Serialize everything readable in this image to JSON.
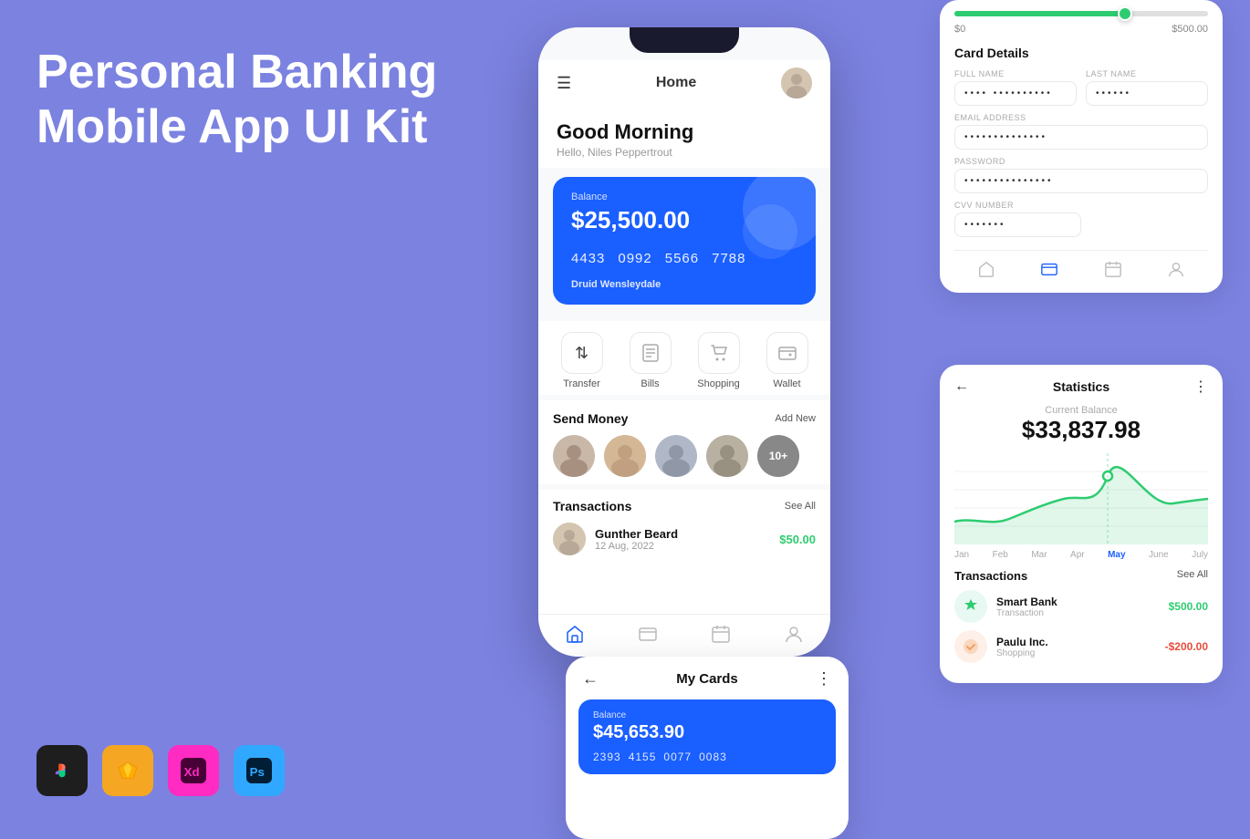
{
  "hero": {
    "title": "Personal Banking Mobile App UI Kit"
  },
  "tools": [
    {
      "name": "Figma",
      "symbol": "✦",
      "class": "tool-figma"
    },
    {
      "name": "Sketch",
      "symbol": "◈",
      "class": "tool-sketch"
    },
    {
      "name": "XD",
      "symbol": "Xd",
      "class": "tool-xd"
    },
    {
      "name": "Ps",
      "symbol": "Ps",
      "class": "tool-ps"
    }
  ],
  "phone_main": {
    "header_title": "Home",
    "greeting_title": "Good Morning",
    "greeting_sub": "Hello, Niles Peppertrout",
    "balance_label": "Balance",
    "balance_amount": "$25,500.00",
    "card_numbers": [
      "4433",
      "0992",
      "5566",
      "7788"
    ],
    "card_holder": "Druid Wensleydale",
    "actions": [
      {
        "label": "Transfer",
        "icon": "↕"
      },
      {
        "label": "Bills",
        "icon": "📋"
      },
      {
        "label": "Shopping",
        "icon": "🛒"
      },
      {
        "label": "Wallet",
        "icon": "▭"
      }
    ],
    "send_money_title": "Send Money",
    "send_money_link": "Add New",
    "contacts_more": "10+",
    "transactions_title": "Transactions",
    "transactions_link": "See All",
    "transaction": {
      "name": "Gunther Beard",
      "date": "12 Aug, 2022",
      "amount": "$50.00"
    }
  },
  "phone_cards": {
    "title": "My Cards",
    "balance_label": "Balance",
    "balance_amount": "$45,653.90",
    "card_numbers": [
      "2393",
      "4155",
      "0077",
      "0083"
    ]
  },
  "card_details_panel": {
    "slider_min": "$0",
    "slider_max": "$500.00",
    "title": "Card Details",
    "full_name_label": "FULL NAME",
    "full_name_value": "•••• ••••••••••",
    "last_name_label": "LAST NAME",
    "last_name_value": "••••••",
    "email_label": "EMAIL ADDRESS",
    "email_value": "••••••••••••••",
    "password_label": "PASSWORD",
    "password_value": "•••••••••••••••",
    "cvv_label": "CVV NUMBER",
    "cvv_value": "•••••••"
  },
  "statistics_panel": {
    "title": "Statistics",
    "balance_label": "Current Balance",
    "balance_amount": "$33,837.98",
    "months": [
      "Jan",
      "Feb",
      "Mar",
      "Apr",
      "May",
      "June",
      "July"
    ],
    "active_month": "May",
    "transactions_title": "Transactions",
    "transactions_link": "See All",
    "transactions": [
      {
        "name": "Smart Bank",
        "category": "Transaction",
        "amount": "$500.00",
        "positive": true
      },
      {
        "name": "Paulu Inc.",
        "category": "Shopping",
        "amount": "-$200.00",
        "positive": false
      }
    ]
  }
}
